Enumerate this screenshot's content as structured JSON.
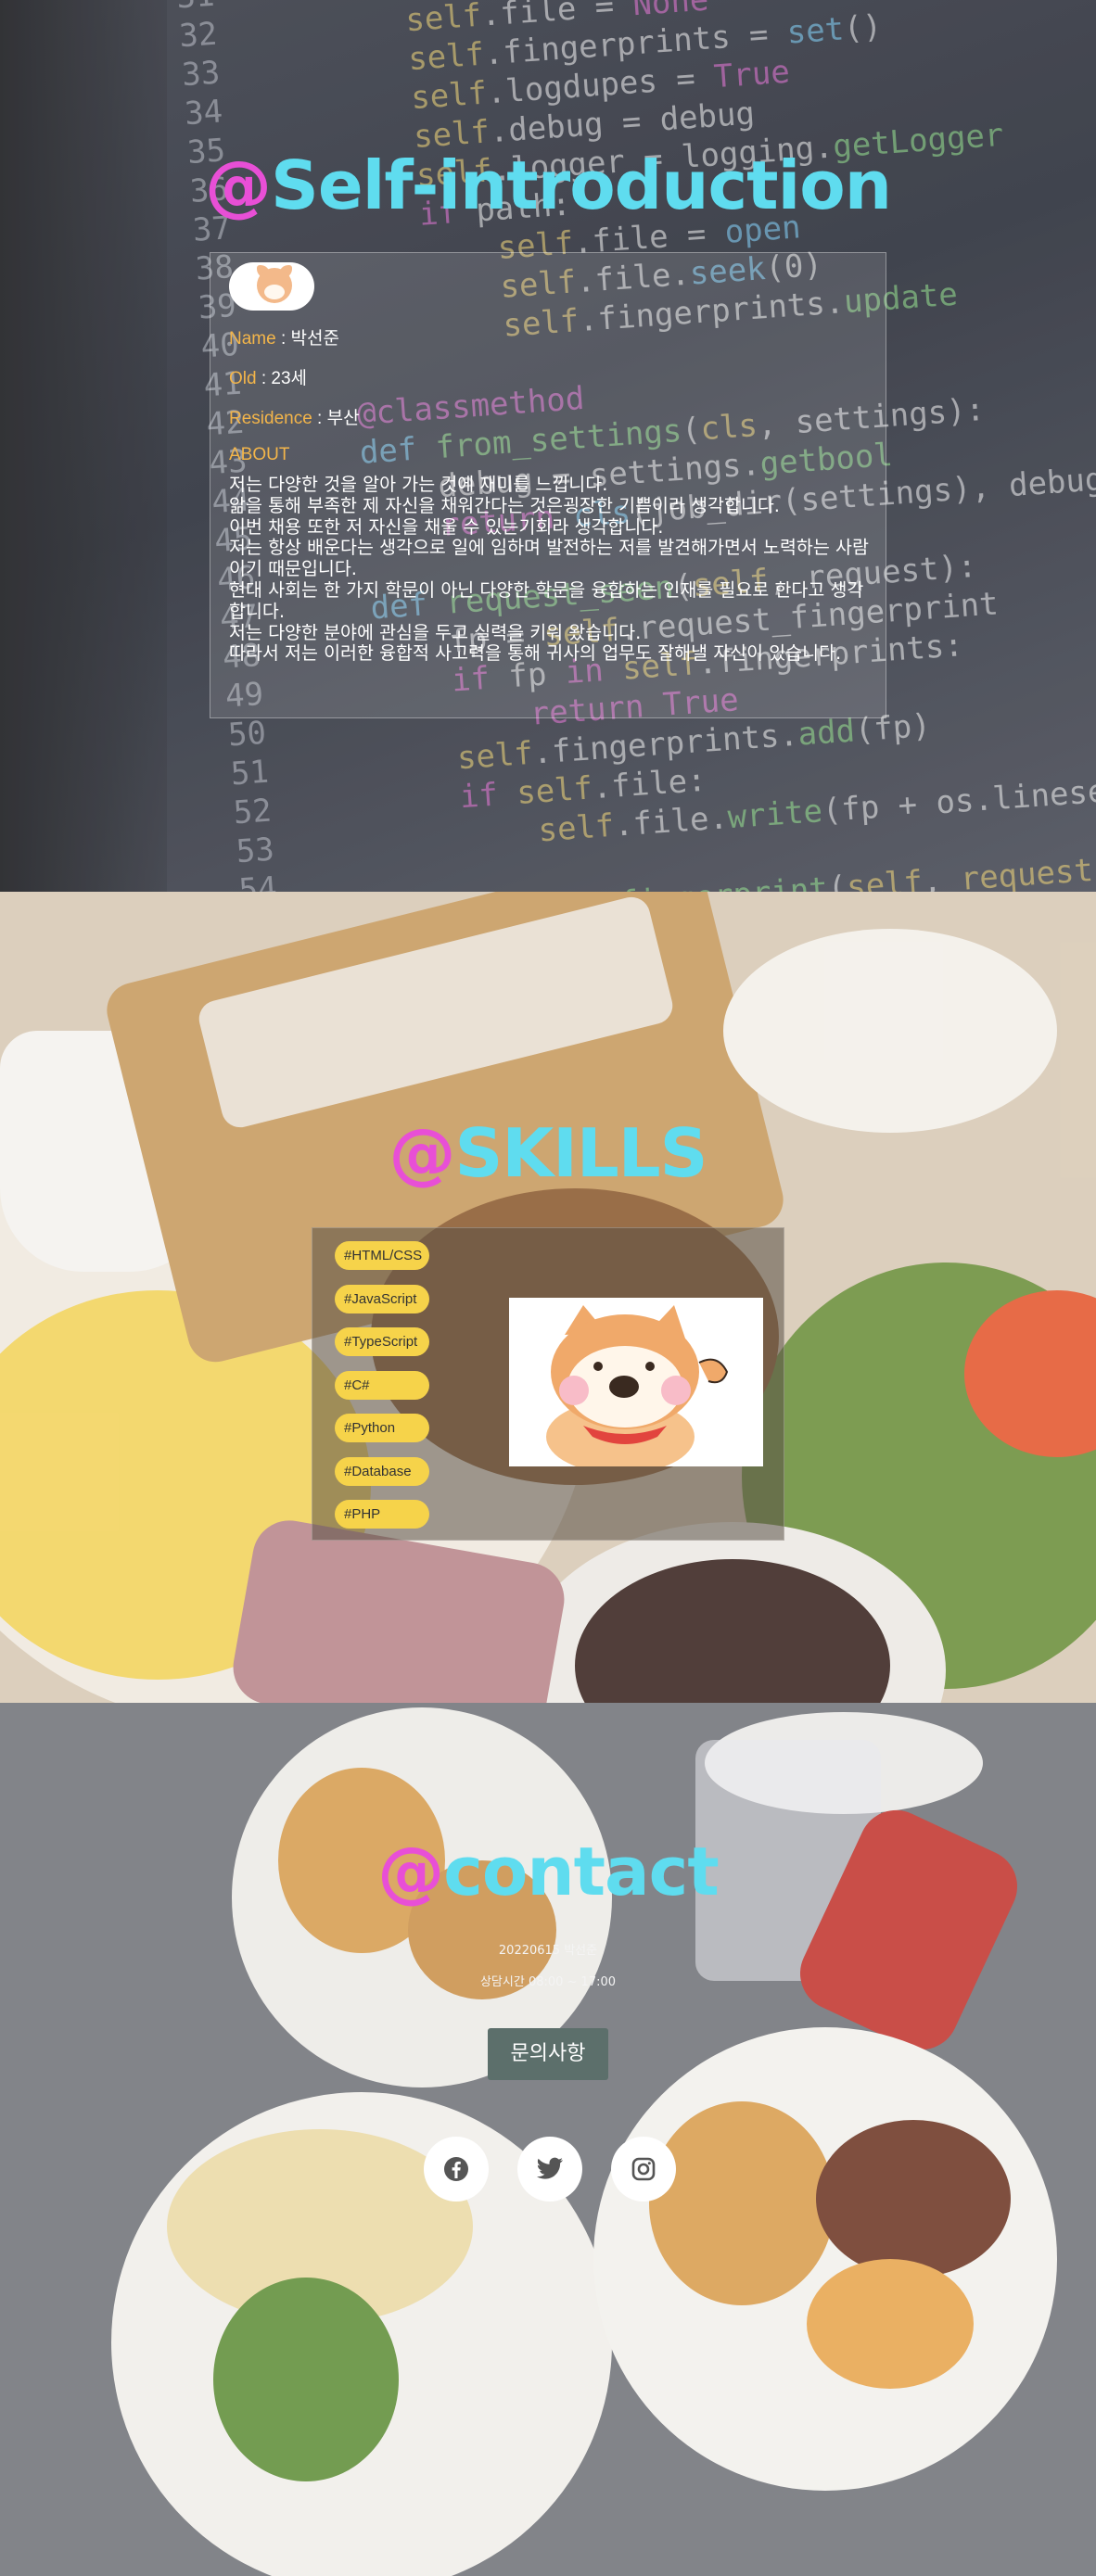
{
  "intro": {
    "title_at": "@",
    "title_word": "Self-introduction",
    "name_key": "Name",
    "name_sep": " : ",
    "name_val": "박선준",
    "old_key": "Old",
    "old_sep": " : ",
    "old_val": "23세",
    "residence_key": "Residence",
    "residence_sep": " : ",
    "residence_val": "부산",
    "about_title": "ABOUT",
    "about_lines": [
      "저는 다양한 것을 알아 가는 것에 재미를 느낍니다.",
      "앎을 통해 부족한 제 자신을 채워간다는 것은굉장한 기쁨이라 생각합니다.",
      "이번 채용 또한 저 자신을 채울 수 있는기회라 생각합니다.",
      "저는 항상 배운다는 생각으로 일에 임하며 발전하는 저를 발견해가면서 노력하는 사람이기 때문입니다.",
      "현대 사회는 한 가지 학문이 아닌 다양한 학문을 융합하는 인재를 필요로 한다고 생각합니다.",
      "저는 다양한 분야에 관심을 두고 실력을 키워 왔습니다.",
      "따라서 저는 이러한 융합적 사고력을 통해 귀사의 업무도 잘해낼 자신이 있습니다."
    ]
  },
  "skills": {
    "title_at": "@",
    "title_word": "SKILLS",
    "tags": [
      "#HTML/CSS",
      "#JavaScript",
      "#TypeScript",
      "#C#",
      "#Python",
      "#Database",
      "#PHP"
    ]
  },
  "contact": {
    "title_at": "@",
    "title_word": "contact",
    "date_line": "20220615 박선준",
    "hours_line": "상담시간 08:00 ~ 17:00",
    "inquiry_label": "문의사항",
    "social": [
      "facebook-icon",
      "twitter-icon",
      "instagram-icon"
    ]
  },
  "colors": {
    "at": "#e84fd6",
    "title": "#5fdcef",
    "label": "#f3b54a",
    "tag": "#f6d34a",
    "button": "#5c6f6b"
  }
}
